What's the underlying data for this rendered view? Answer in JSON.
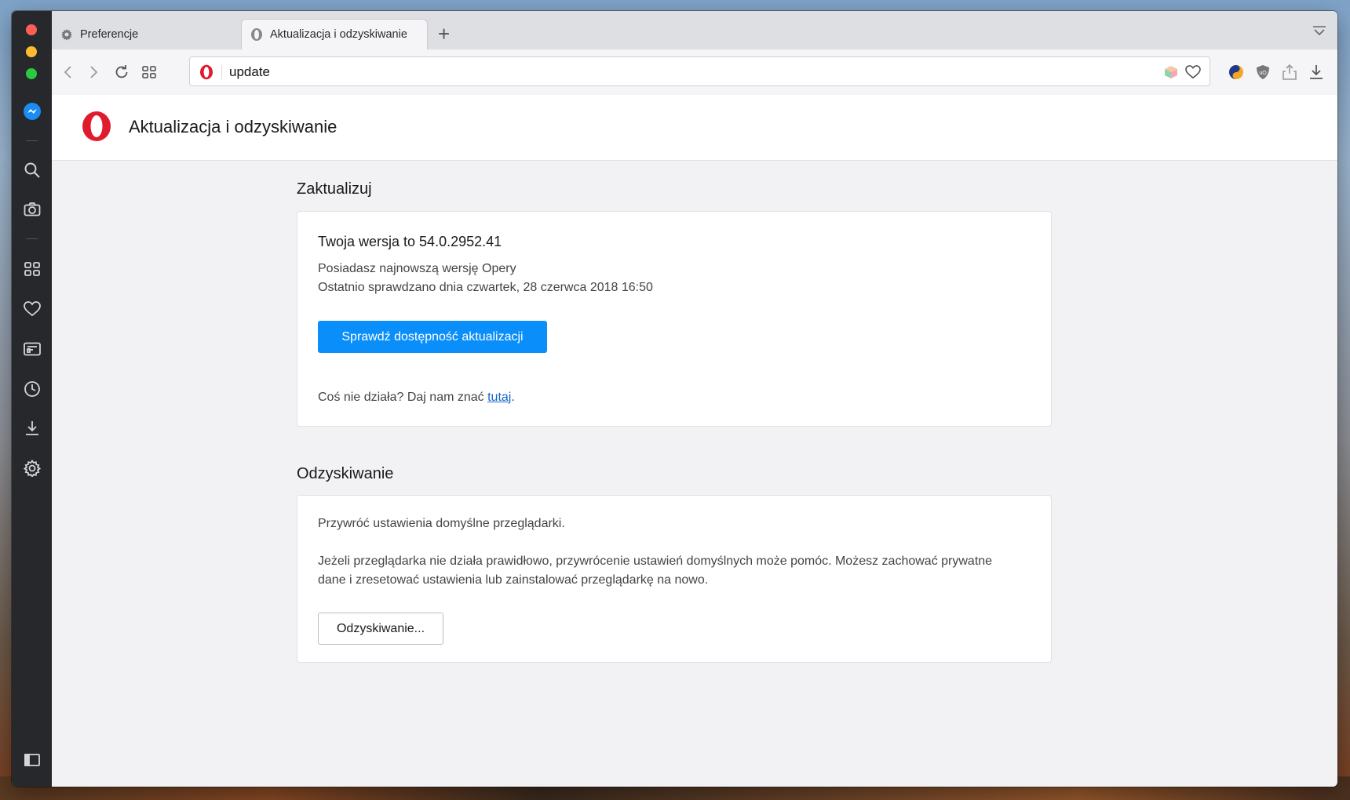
{
  "tabs": [
    {
      "label": "Preferencje",
      "icon": "gear-icon"
    },
    {
      "label": "Aktualizacja i odzyskiwanie",
      "icon": "opera-icon"
    }
  ],
  "address_bar": {
    "url": "update"
  },
  "page": {
    "title": "Aktualizacja i odzyskiwanie"
  },
  "update_section": {
    "title": "Zaktualizuj",
    "version": "Twoja wersja to 54.0.2952.41",
    "status": "Posiadasz najnowszą wersję Opery",
    "last_checked": "Ostatnio sprawdzano dnia czwartek, 28 czerwca 2018 16:50",
    "check_button": "Sprawdź dostępność aktualizacji",
    "feedback_prefix": "Coś nie działa? Daj nam znać ",
    "feedback_link": "tutaj",
    "feedback_suffix": "."
  },
  "recovery_section": {
    "title": "Odzyskiwanie",
    "subtitle": "Przywróć ustawienia domyślne przeglądarki.",
    "description": "Jeżeli przeglądarka nie działa prawidłowo, przywrócenie ustawień domyślnych może pomóc. Możesz zachować prywatne dane i zresetować ustawienia lub zainstalować przeglądarkę na nowo.",
    "button": "Odzyskiwanie..."
  },
  "colors": {
    "accent": "#0a8ef9",
    "opera_red": "#e01b2c",
    "sidebar": "#26282b"
  }
}
